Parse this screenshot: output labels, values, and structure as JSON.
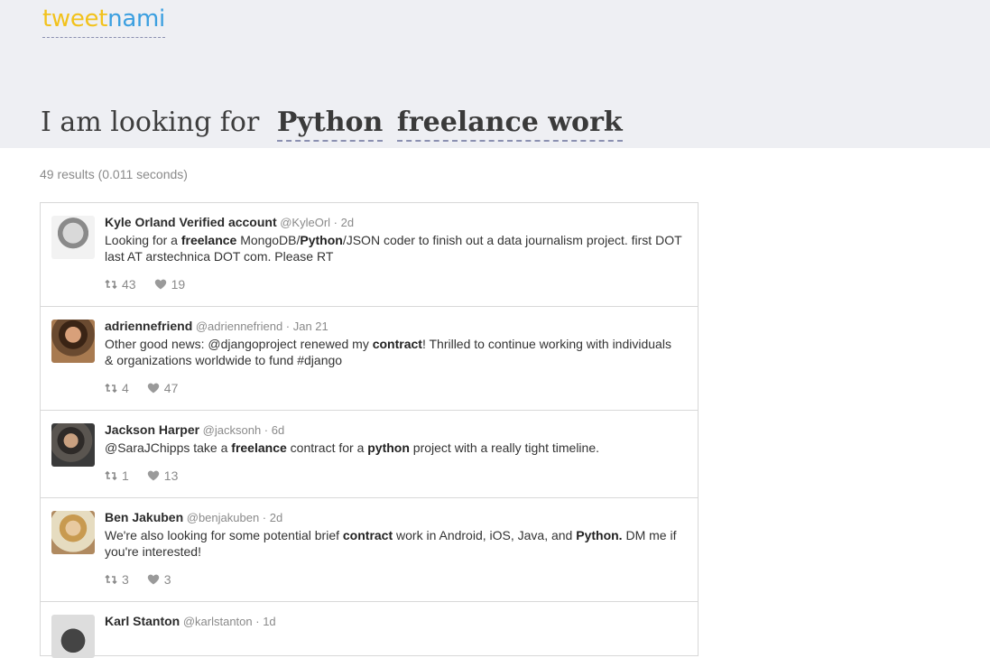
{
  "logo": {
    "part1": "tweet",
    "part2": "nami"
  },
  "search": {
    "prefix": "I am looking for",
    "term1": "Python",
    "term2": "freelance work"
  },
  "results_summary": "49 results (0.011 seconds)",
  "colors": {
    "logo_tweet": "#f2c21b",
    "logo_nami": "#3b9fe0",
    "header_bg": "#eeeff3"
  },
  "tweets": [
    {
      "name": "Kyle Orland Verified account",
      "handle": "@KyleOrl",
      "time": "2d",
      "text_html": "Looking for a <b>freelance</b> MongoDB/<b>Python</b>/JSON coder to finish out a data journalism project. first DOT last AT arstechnica DOT com. Please RT",
      "retweets": "43",
      "likes": "19"
    },
    {
      "name": "adriennefriend",
      "handle": "@adriennefriend",
      "time": "Jan 21",
      "text_html": "Other good news: @djangoproject renewed my <b>contract</b>! Thrilled to continue working with individuals &amp; organizations worldwide to fund #django",
      "retweets": "4",
      "likes": "47"
    },
    {
      "name": "Jackson Harper",
      "handle": "@jacksonh",
      "time": "6d",
      "text_html": "@SaraJChipps take a <b>freelance</b> contract for a <b>python</b> project with a really tight timeline.",
      "retweets": "1",
      "likes": "13"
    },
    {
      "name": "Ben Jakuben",
      "handle": "@benjakuben",
      "time": "2d",
      "text_html": "We're also looking for some potential brief <b>contract</b> work in Android, iOS, Java, and <b>Python.</b> DM me if you're interested!",
      "retweets": "3",
      "likes": "3"
    },
    {
      "name": "Karl Stanton",
      "handle": "@karlstanton",
      "time": "1d",
      "text_html": "",
      "retweets": "",
      "likes": ""
    }
  ]
}
